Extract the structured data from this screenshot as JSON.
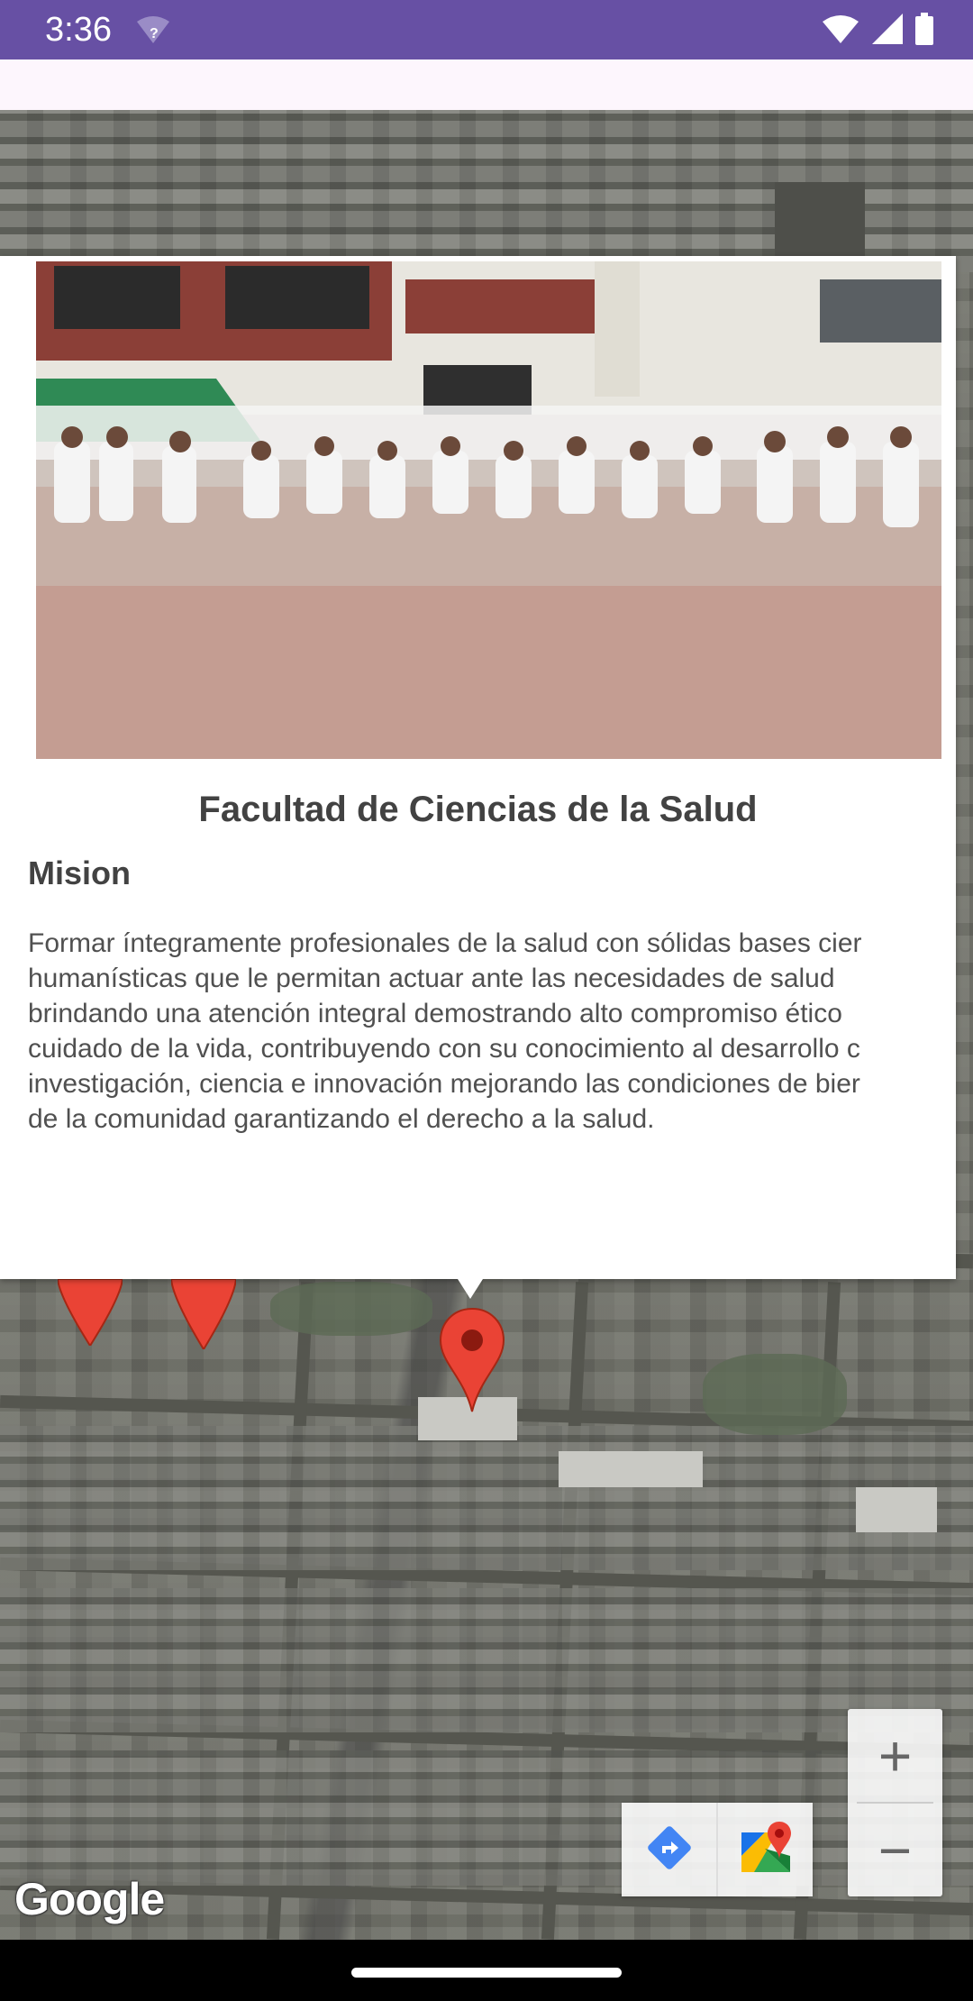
{
  "status_bar": {
    "time": "3:36",
    "icons": [
      "wifi-question-icon",
      "wifi-icon",
      "signal-icon",
      "battery-icon"
    ]
  },
  "info_window": {
    "photo_desc_icon": "faculty-group-photo",
    "title": "Facultad de Ciencias de la Salud",
    "subtitle": "Mision",
    "body_lines": [
      "Formar íntegramente profesionales de la salud con sólidas bases cier",
      "humanísticas que le permitan actuar ante las necesidades de salud",
      "brindando una atención integral demostrando alto compromiso ético",
      "cuidado de la vida, contribuyendo con su conocimiento al desarrollo c",
      "investigación, ciencia e innovación mejorando las condiciones de bier",
      "de la comunidad garantizando el derecho a la salud."
    ]
  },
  "map": {
    "marker_color": "#ea4335",
    "markers": [
      "map-marker-1",
      "map-marker-2",
      "map-marker-selected"
    ]
  },
  "zoom": {
    "in_label": "+",
    "out_label": "−"
  },
  "toolbar": {
    "directions_icon": "directions-icon",
    "maps_icon": "google-maps-icon"
  },
  "google_logo": "Google",
  "colors": {
    "status_bar": "#6750a4",
    "app_bar": "#fdf6fd"
  }
}
